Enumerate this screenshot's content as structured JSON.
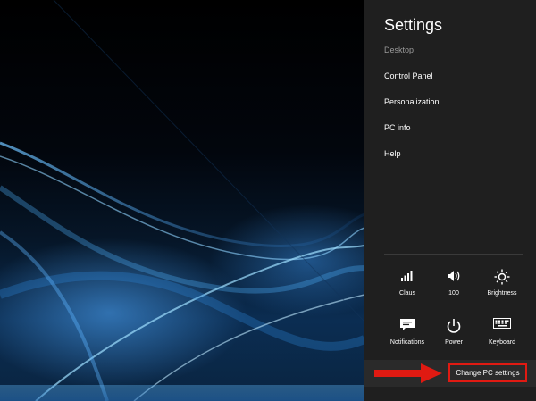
{
  "settings": {
    "title": "Settings",
    "subtitle": "Desktop",
    "menu": [
      "Control Panel",
      "Personalization",
      "PC info",
      "Help"
    ]
  },
  "quick_settings": [
    {
      "label": "Claus",
      "icon": "signal-bars-icon"
    },
    {
      "label": "100",
      "icon": "volume-icon"
    },
    {
      "label": "Brightness",
      "icon": "brightness-icon"
    },
    {
      "label": "Notifications",
      "icon": "notifications-icon"
    },
    {
      "label": "Power",
      "icon": "power-icon"
    },
    {
      "label": "Keyboard",
      "icon": "keyboard-icon"
    }
  ],
  "change_pc_settings": "Change PC settings",
  "colors": {
    "charm_bg": "#1f1f1f",
    "highlight": "#e01a12"
  }
}
